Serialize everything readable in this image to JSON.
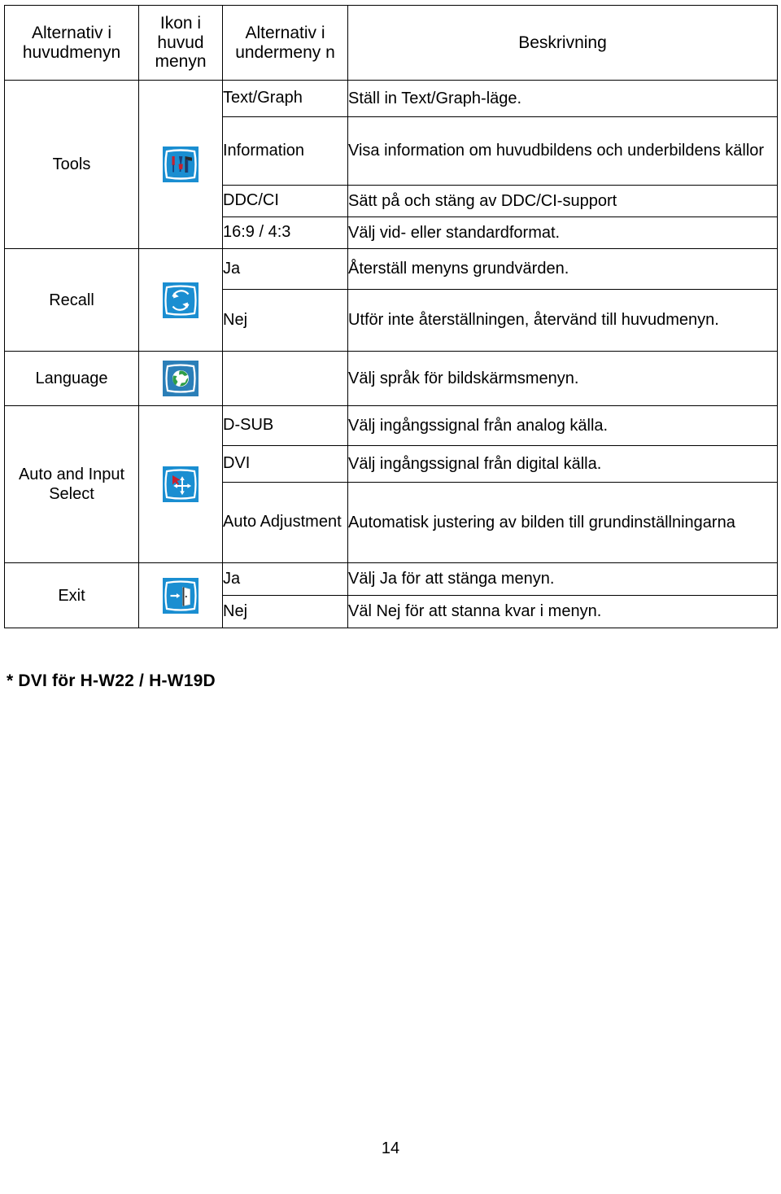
{
  "document": {
    "page_number": "14",
    "footnote": "* DVI för H-W22 / H-W19D"
  },
  "table": {
    "headers": {
      "main_menu": "Alternativ i huvudmenyn",
      "icon": "Ikon i huvud menyn",
      "submenu": "Alternativ i undermeny n",
      "description": "Beskrivning"
    },
    "groups": [
      {
        "main_label": "Tools",
        "icon": "tools-icon",
        "rows": [
          {
            "submenu": "Text/Graph",
            "description": "Ställ in Text/Graph-läge."
          },
          {
            "submenu": "Information",
            "description": "Visa information om huvudbildens och underbildens källor"
          },
          {
            "submenu": "DDC/CI",
            "description": "Sätt på och stäng av DDC/CI-support"
          },
          {
            "submenu": "16:9 / 4:3",
            "description": "Välj vid- eller standardformat."
          }
        ]
      },
      {
        "main_label": "Recall",
        "icon": "recall-icon",
        "rows": [
          {
            "submenu": "Ja",
            "description": "Återställ menyns grundvärden."
          },
          {
            "submenu": "Nej",
            "description": "Utför inte återställningen, återvänd till huvudmenyn."
          }
        ]
      },
      {
        "main_label": "Language",
        "icon": "language-icon",
        "rows": [
          {
            "submenu": "",
            "description": "Välj språk för bildskärmsmenyn."
          }
        ]
      },
      {
        "main_label": "Auto and Input Select",
        "icon": "auto-input-select-icon",
        "rows": [
          {
            "submenu": "D-SUB",
            "description": "Välj ingångssignal från analog källa."
          },
          {
            "submenu": "DVI",
            "description": "Välj ingångssignal från digital källa."
          },
          {
            "submenu": "Auto Adjustment",
            "description": "Automatisk justering av bilden till grundinställningarna"
          }
        ]
      },
      {
        "main_label": "Exit",
        "icon": "exit-icon",
        "rows": [
          {
            "submenu": "Ja",
            "description": "Välj Ja för att stänga menyn."
          },
          {
            "submenu": "Nej",
            "description": "Väl Nej för att stanna kvar i menyn."
          }
        ]
      }
    ]
  },
  "colors": {
    "icon_blue": "#1a8ed1",
    "icon_outline": "#ffffff",
    "cursor_red": "#c8202e",
    "globe_green": "#2e9e47",
    "border": "#000000",
    "text": "#000000"
  }
}
